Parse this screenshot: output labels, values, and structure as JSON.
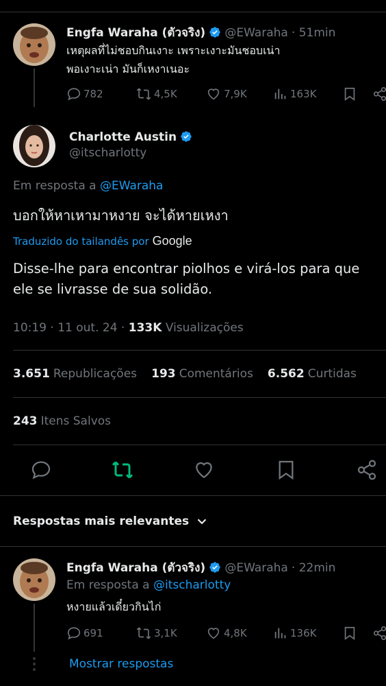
{
  "tweet1": {
    "name": "Engfa Waraha (ตัวจริง)",
    "handle": "@EWaraha",
    "time": "· 51min",
    "text_line1": "เหตุผลที่ไม่ชอบกินเงาะ เพราะเงาะมันชอบเน่า",
    "text_line2": "พอเงาะเน่า มันก็เหงาเนอะ",
    "replies": "782",
    "retweets": "4,5K",
    "likes": "7,9K",
    "views": "163K"
  },
  "main": {
    "name": "Charlotte Austin",
    "handle": "@itscharlotty",
    "reply_prefix": "Em resposta a",
    "reply_to": "@EWaraha",
    "text": "บอกให้หาเหามาหงาย จะได้หายเหงา",
    "translated_by": "Traduzido do tailandês por",
    "google": "Google",
    "translation_line1": "Disse-lhe para encontrar piolhos e virá-los para que",
    "translation_line2": "ele se livrasse de sua solidão.",
    "timestamp": "10:19 · 11 out. 24 ·",
    "views_count": "133K",
    "views_label": "Visualizações",
    "reposts_count": "3.651",
    "reposts_label": "Republicações",
    "comments_count": "193",
    "comments_label": "Comentários",
    "likes_count": "6.562",
    "likes_label": "Curtidas",
    "saved_count": "243",
    "saved_label": "Itens Salvos"
  },
  "relevant_replies": "Respostas mais relevantes",
  "reply": {
    "name": "Engfa Waraha (ตัวจริง)",
    "handle": "@EWaraha",
    "time": "· 22min",
    "reply_prefix": "Em resposta a",
    "reply_to": "@itscharlotty",
    "text": "หงายแล้วเดี๋ยวกินไก่",
    "replies": "691",
    "retweets": "3,1K",
    "likes": "4,8K",
    "views": "136K"
  },
  "show_replies": "Mostrar respostas",
  "colors": {
    "accent": "#1d9bf0",
    "retweet_active": "#00ba7c",
    "muted": "#71767b"
  }
}
